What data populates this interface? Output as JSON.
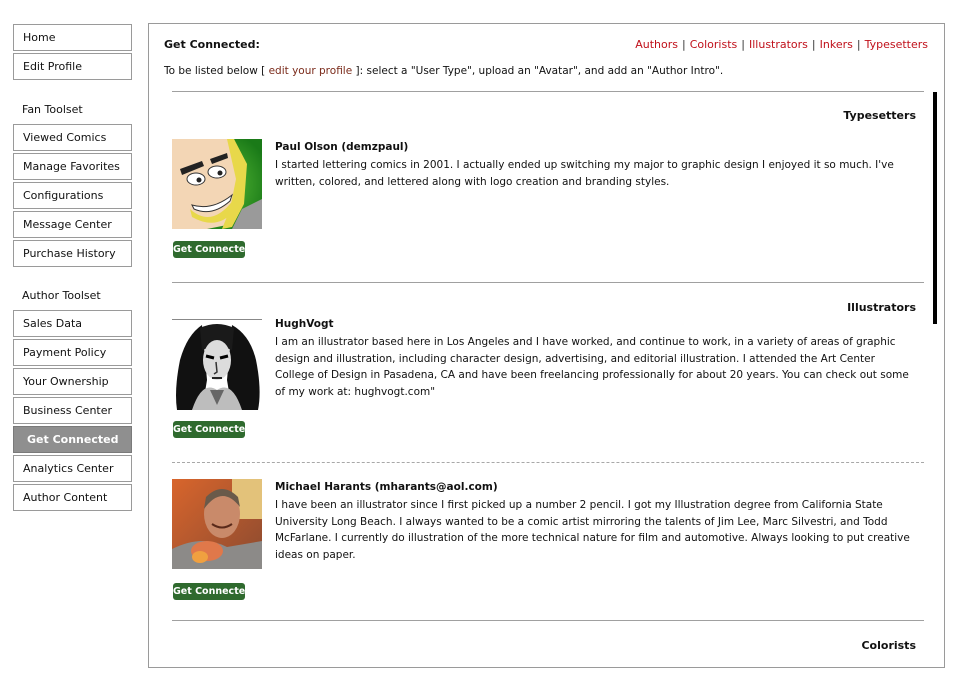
{
  "sidebar": {
    "top_items": [
      {
        "label": "Home"
      },
      {
        "label": "Edit Profile"
      }
    ],
    "fan_toolset": {
      "heading": "Fan Toolset",
      "items": [
        {
          "label": "Viewed Comics"
        },
        {
          "label": "Manage Favorites"
        },
        {
          "label": "Configurations"
        },
        {
          "label": "Message Center"
        },
        {
          "label": "Purchase History"
        }
      ]
    },
    "author_toolset": {
      "heading": "Author Toolset",
      "items": [
        {
          "label": "Sales Data"
        },
        {
          "label": "Payment Policy"
        },
        {
          "label": "Your Ownership"
        },
        {
          "label": "Business Center"
        },
        {
          "label": "Get Connected",
          "active": true
        },
        {
          "label": "Analytics Center"
        },
        {
          "label": "Author Content"
        }
      ]
    }
  },
  "main": {
    "title": "Get Connected:",
    "intro": {
      "before": "To be listed below [ ",
      "link": "edit your profile",
      "after": " ]: select a \"User Type\", upload an \"Avatar\", and add an \"Author Intro\"."
    },
    "type_links": [
      "Authors",
      "Colorists",
      "Illustrators",
      "Inkers",
      "Typesetters"
    ],
    "type_separator": "|",
    "connect_label": "Get Connected",
    "sections": [
      {
        "heading": "Typesetters",
        "entries": [
          {
            "name": "Paul Olson (demzpaul)",
            "bio": "I started lettering comics in 2001. I actually ended up switching my major to graphic design I enjoyed it so much. I've written, colored, and lettered along with logo creation and branding styles.",
            "avatar": "cartoon-avatar"
          }
        ]
      },
      {
        "heading": "Illustrators",
        "entries": [
          {
            "name": "HughVogt",
            "bio": "I am an illustrator based here in Los Angeles and I have worked, and continue to work, in a variety of areas of graphic design and illustration, including character design, advertising, and editorial illustration. I attended the Art Center College of Design in Pasadena, CA and have been freelancing professionally for about 20 years. You can check out some of my work at: hughvogt.com\"",
            "avatar": "ink-portrait-avatar"
          },
          {
            "name": "Michael Harants (mharants@aol.com)",
            "bio": "I have been an illustrator since I first picked up a number 2 pencil. I got my Illustration degree from California State University Long Beach. I always wanted to be a comic artist mirroring the talents of Jim Lee, Marc Silvestri, and Todd McFarlane. I currently do illustration of the more technical nature for film and automotive. Always looking to put creative ideas on paper.",
            "avatar": "photo-avatar"
          }
        ]
      },
      {
        "heading": "Colorists",
        "entries": []
      }
    ]
  },
  "colors": {
    "link_red": "#c0101a",
    "intro_link": "#7a2a1a",
    "connect_green": "#2f6a2e",
    "active_nav": "#8f8f8f"
  }
}
